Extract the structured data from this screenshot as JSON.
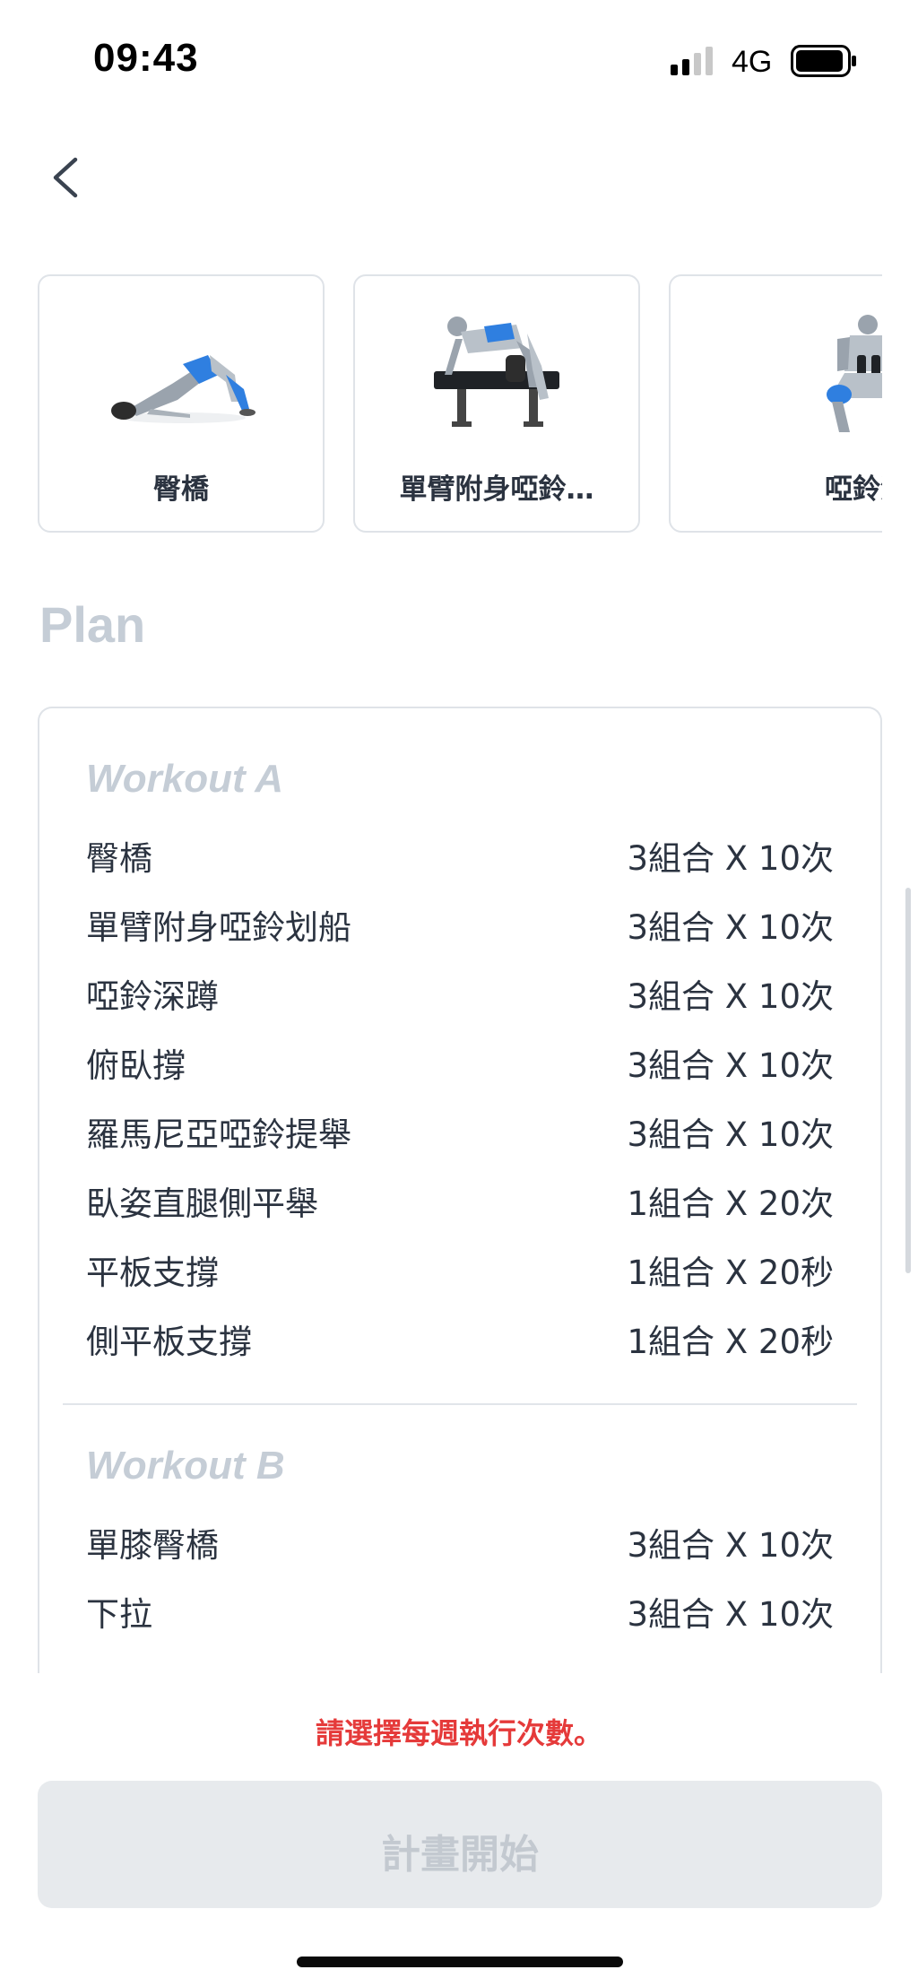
{
  "status_bar": {
    "time": "09:43",
    "network": "4G"
  },
  "exercises": [
    {
      "label": "臀橋",
      "image": "glute-bridge-illustration"
    },
    {
      "label": "單臂附身啞鈴…",
      "image": "one-arm-dumbbell-row-illustration"
    },
    {
      "label": "啞鈴深蹲",
      "image": "dumbbell-squat-illustration"
    }
  ],
  "plan": {
    "title": "Plan",
    "workouts": [
      {
        "title": "Workout A",
        "items": [
          {
            "name": "臀橋",
            "qty": "3組合 X 10次"
          },
          {
            "name": "單臂附身啞鈴划船",
            "qty": "3組合 X 10次"
          },
          {
            "name": "啞鈴深蹲",
            "qty": "3組合 X 10次"
          },
          {
            "name": "俯臥撐",
            "qty": "3組合 X 10次"
          },
          {
            "name": "羅馬尼亞啞鈴提舉",
            "qty": "3組合 X 10次"
          },
          {
            "name": "臥姿直腿側平舉",
            "qty": "1組合 X 20次"
          },
          {
            "name": "平板支撐",
            "qty": "1組合 X 20秒"
          },
          {
            "name": "側平板支撐",
            "qty": "1組合 X 20秒"
          }
        ]
      },
      {
        "title": "Workout B",
        "items": [
          {
            "name": "單膝臀橋",
            "qty": "3組合 X 10次"
          },
          {
            "name": "下拉",
            "qty": "3組合 X 10次"
          }
        ]
      }
    ]
  },
  "warning": "請選擇每週執行次數。",
  "start_button": "計畫開始",
  "colors": {
    "warning": "#e53a3a",
    "muted": "#c5cdd6",
    "text": "#2b3340",
    "button_bg": "#e7eaed"
  }
}
